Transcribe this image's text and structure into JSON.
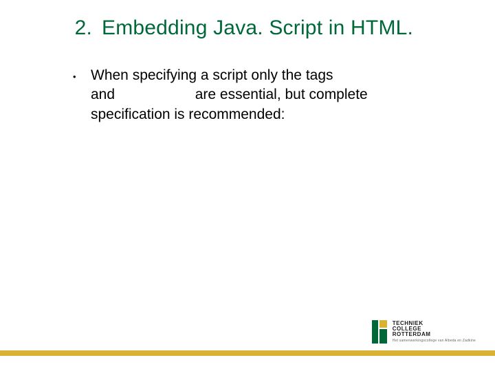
{
  "heading": {
    "number": "2.",
    "title": "Embedding Java. Script in HTML."
  },
  "bullet": "•",
  "body": {
    "line1": "When specifying a script only the tags",
    "line2_a": "and",
    "line2_b": "are essential, but complete",
    "line3": "specification is recommended:"
  },
  "logo": {
    "line1": "TECHNIEK",
    "line2": "COLLEGE",
    "line3": "ROTTERDAM",
    "sub": "Het samenwerkingscollege van Albeda en Zadkine"
  }
}
